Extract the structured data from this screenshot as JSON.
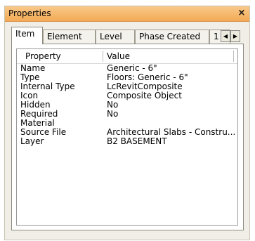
{
  "window": {
    "title": "Properties",
    "close_glyph": "×"
  },
  "tabs": [
    {
      "label": "Item"
    },
    {
      "label": "Element"
    },
    {
      "label": "Level"
    },
    {
      "label": "Phase Created"
    },
    {
      "label": "1"
    }
  ],
  "tab_scroll": {
    "left_glyph": "◀",
    "right_glyph": "▶"
  },
  "grid": {
    "columns": [
      "Property",
      "Value"
    ],
    "rows": [
      {
        "property": "Name",
        "value": "Generic - 6\""
      },
      {
        "property": "Type",
        "value": "Floors: Generic - 6\""
      },
      {
        "property": "Internal Type",
        "value": "LcRevitComposite"
      },
      {
        "property": "Icon",
        "value": "Composite Object"
      },
      {
        "property": "Hidden",
        "value": "No"
      },
      {
        "property": "Required",
        "value": "No"
      },
      {
        "property": "Material",
        "value": ""
      },
      {
        "property": "Source File",
        "value": "Architectural Slabs - Constru..."
      },
      {
        "property": "Layer",
        "value": "B2 BASEMENT"
      }
    ]
  }
}
